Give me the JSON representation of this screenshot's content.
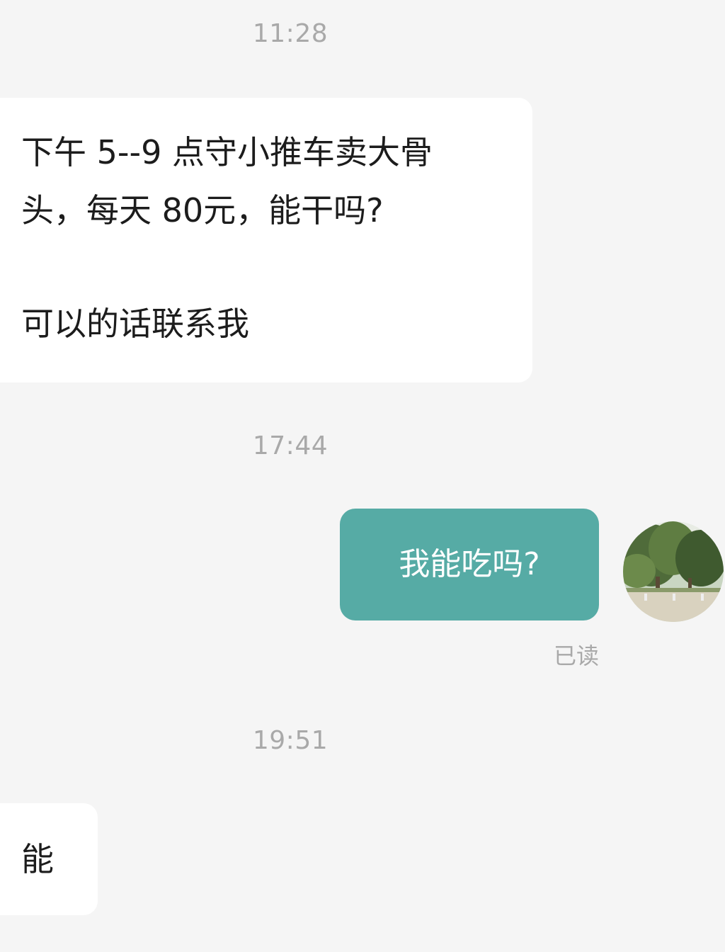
{
  "conversation": {
    "timestamps": [
      "11:28",
      "17:44",
      "19:51"
    ],
    "incoming_message_1": {
      "lines": [
        "下午 5--9 点守小推车卖大骨",
        "头，每天 80元，能干吗?",
        "可以的话联系我"
      ]
    },
    "outgoing_message": {
      "text": "我能吃吗?",
      "status": "已读",
      "bubble_color": "#56aba5"
    },
    "incoming_message_2": {
      "text": "能"
    }
  },
  "colors": {
    "background": "#f5f5f5",
    "incoming_bubble": "#ffffff",
    "timestamp_text": "#a9a9a9"
  }
}
